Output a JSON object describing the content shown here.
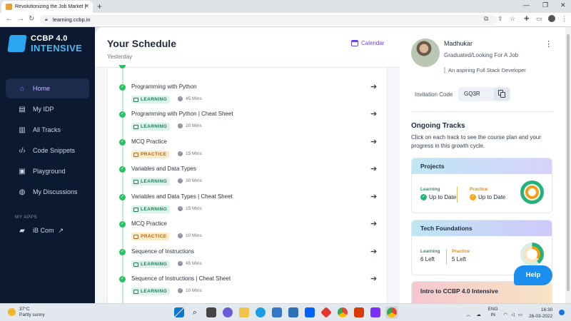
{
  "browser": {
    "tab_title": "Revolutionizing the Job Market |",
    "url": "learning.ccbp.in"
  },
  "sidebar": {
    "logo_line1": "CCBP 4.0",
    "logo_line2": "INTENSIVE",
    "items": [
      {
        "label": "Home",
        "icon": "home-icon",
        "active": true
      },
      {
        "label": "My IDP",
        "icon": "idp-icon"
      },
      {
        "label": "All Tracks",
        "icon": "tracks-icon"
      },
      {
        "label": "Code Snippets",
        "icon": "code-icon"
      },
      {
        "label": "Playground",
        "icon": "terminal-icon"
      },
      {
        "label": "My Discussions",
        "icon": "discussions-icon"
      }
    ],
    "apps_heading": "MY APPS",
    "app_label": "iB Com"
  },
  "schedule": {
    "title": "Your Schedule",
    "subtitle": "Yesterday",
    "calendar_label": "Calendar",
    "items": [
      {
        "title": "Programming with Python",
        "tag": "LEARNING",
        "duration": "45 Mins"
      },
      {
        "title": "Programming with Python | Cheat Sheet",
        "tag": "LEARNING",
        "duration": "20 Mins"
      },
      {
        "title": "MCQ Practice",
        "tag": "PRACTICE",
        "duration": "15 Mins"
      },
      {
        "title": "Variables and Data Types",
        "tag": "LEARNING",
        "duration": "30 Mins"
      },
      {
        "title": "Variables and Data Types | Cheat Sheet",
        "tag": "LEARNING",
        "duration": "15 Mins"
      },
      {
        "title": "MCQ Practice",
        "tag": "PRACTICE",
        "duration": "10 Mins"
      },
      {
        "title": "Sequence of Instructions",
        "tag": "LEARNING",
        "duration": "45 Mins"
      },
      {
        "title": "Sequence of Instructions | Cheat Sheet",
        "tag": "LEARNING",
        "duration": "10 Mins"
      }
    ]
  },
  "profile": {
    "name": "Madhukar",
    "status": "Graduated/Looking For A Job",
    "aspiration": "An aspiring Full Stack Developer",
    "invitation_label": "Invitation Code",
    "invitation_code": "GQ3R"
  },
  "tracks": {
    "title": "Ongoing Tracks",
    "description": "Click on each track to see the course plan and your progress in this growth cycle.",
    "learning_label": "Learning",
    "practice_label": "Practice",
    "cards": [
      {
        "name": "Projects",
        "learning": "Up to Date",
        "practice": "Up to Date"
      },
      {
        "name": "Tech Foundations",
        "learning": "6 Left",
        "practice": "5 Left"
      },
      {
        "name": "Intro to CCBP 4.0 Intensive"
      }
    ],
    "help_label": "Help"
  },
  "taskbar": {
    "weather_temp": "37°C",
    "weather_desc": "Partly sunny",
    "lang1": "ENG",
    "lang2": "IN",
    "time": "16:30",
    "date": "26-03-2022"
  },
  "colors": {
    "sidebar_bg": "#0b1a30",
    "accent_purple": "#6b46e0",
    "learning_green": "#1b7d57",
    "practice_orange": "#b5651d",
    "help_blue": "#1c8ef0"
  }
}
